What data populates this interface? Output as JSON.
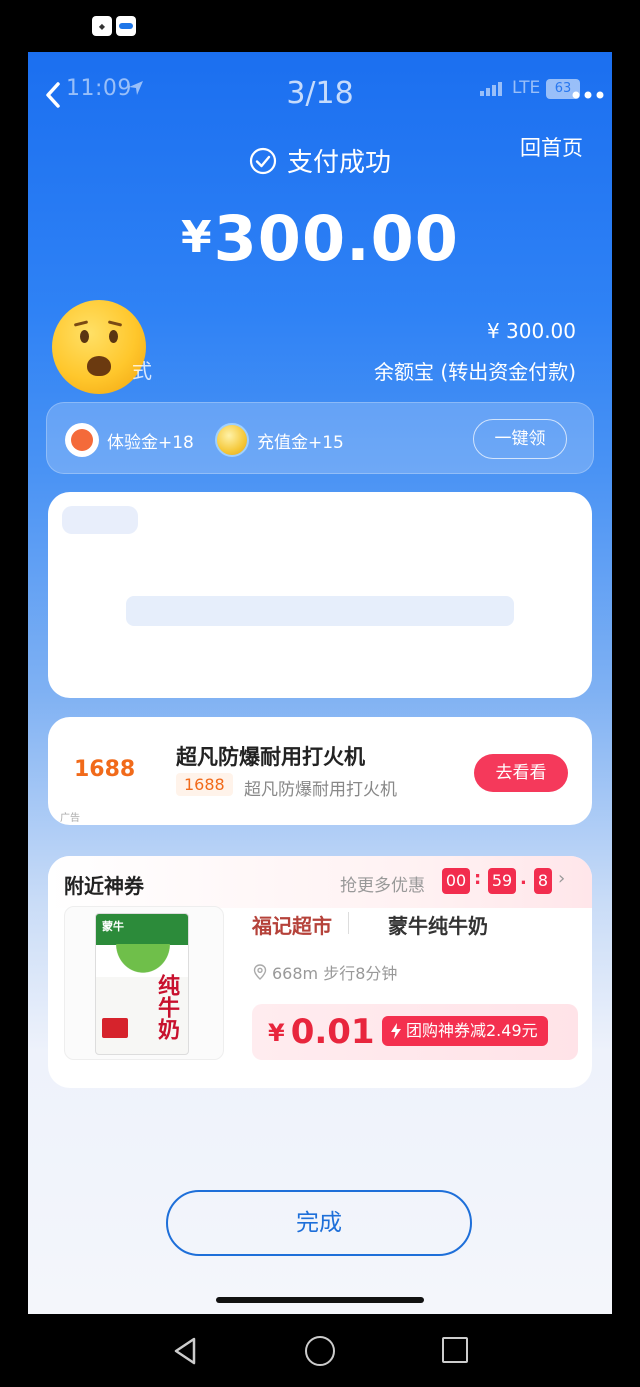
{
  "status_bar": {
    "time": "11:09",
    "page_counter": "3/18",
    "network": "LTE",
    "battery": "63"
  },
  "header": {
    "home_link": "回首页",
    "success_text": "支付成功",
    "currency": "¥",
    "amount": "300.00"
  },
  "payment": {
    "method_partial": "式",
    "paid_amount": "¥ 300.00",
    "paid_method": "余额宝 (转出资金付款)"
  },
  "bonus": {
    "trial_label": "体验金+18",
    "recharge_label": "充值金+15",
    "claim_button": "一键领"
  },
  "ad": {
    "logo": "1688",
    "title": "超凡防爆耐用打火机",
    "sub_logo": "1688",
    "subtitle": "超凡防爆耐用打火机",
    "tag": "广告",
    "button": "去看看"
  },
  "coupon": {
    "title": "附近神券",
    "more_deals": "抢更多优惠",
    "countdown": {
      "hours": "00",
      "minutes": "59",
      "tenths": "8"
    },
    "store": "福记超市",
    "product": "蒙牛纯牛奶",
    "product_image_text": "纯牛奶",
    "product_brand": "蒙牛",
    "distance": "668m 步行8分钟",
    "currency": "¥",
    "price": "0.01",
    "deal_badge": "团购神券减2.49元"
  },
  "actions": {
    "done_button": "完成"
  },
  "colors": {
    "brand_blue": "#1b6ff0",
    "accent_red": "#f4304f",
    "ad_orange": "#f16a1a"
  }
}
